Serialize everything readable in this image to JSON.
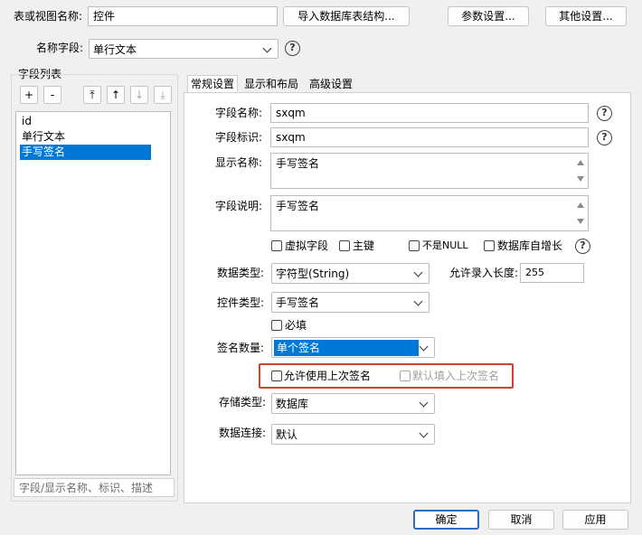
{
  "top": {
    "table_name_label": "表或视图名称:",
    "table_name_value": "控件",
    "import_button": "导入数据库表结构...",
    "param_button": "参数设置...",
    "other_button": "其他设置...",
    "name_field_label": "名称字段:",
    "name_field_value": "单行文本"
  },
  "field_list": {
    "title": "字段列表",
    "tools": [
      "+",
      "-",
      "⤒",
      "↑",
      "↓",
      "⤓"
    ],
    "items": [
      "id",
      "单行文本",
      "手写签名"
    ],
    "selected_index": 2,
    "search_placeholder": "字段/显示名称、标识、描述"
  },
  "tabs": [
    "常规设置",
    "显示和布局",
    "高级设置"
  ],
  "general": {
    "field_name_label": "字段名称:",
    "field_name_value": "sxqm",
    "field_id_label": "字段标识:",
    "field_id_value": "sxqm",
    "display_name_label": "显示名称:",
    "display_name_value": "手写签名",
    "desc_label": "字段说明:",
    "desc_value": "手写签名",
    "checkboxes": [
      {
        "label": "虚拟字段",
        "checked": false
      },
      {
        "label": "主键",
        "checked": false
      },
      {
        "label": "不是NULL",
        "checked": false
      },
      {
        "label": "数据库自增长",
        "checked": false
      }
    ],
    "data_type_label": "数据类型:",
    "data_type_value": "字符型(String)",
    "max_len_label": "允许录入长度:",
    "max_len_value": "255",
    "control_type_label": "控件类型:",
    "control_type_value": "手写签名",
    "required_label": "必填",
    "sign_count_label": "签名数量:",
    "sign_count_value": "单个签名",
    "allow_last_label": "允许使用上次签名",
    "default_last_label": "默认填入上次签名",
    "storage_label": "存储类型:",
    "storage_value": "数据库",
    "conn_label": "数据连接:",
    "conn_value": "默认"
  },
  "footer": {
    "ok": "确定",
    "cancel": "取消",
    "apply": "应用"
  },
  "colors": {
    "selection": "#0078d7",
    "highlight_border": "#c9462e",
    "primary_border": "#2d6bc3"
  }
}
